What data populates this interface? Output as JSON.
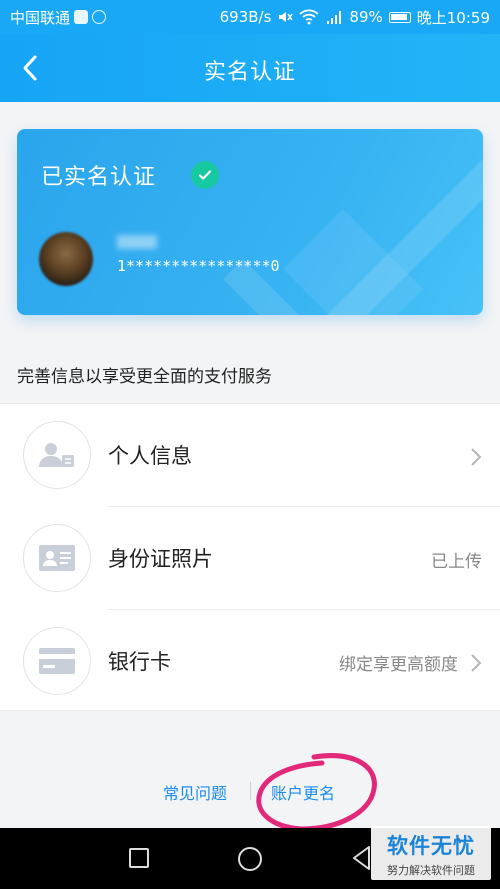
{
  "status_bar": {
    "carrier": "中国联通",
    "speed": "693B/s",
    "battery": "89%",
    "time": "晚上10:59"
  },
  "header": {
    "title": "实名认证"
  },
  "card": {
    "title": "已实名认证",
    "id_masked": "1****************0"
  },
  "subtitle": "完善信息以享受更全面的支付服务",
  "items": [
    {
      "label": "个人信息",
      "value": "",
      "icon": "person-info-icon"
    },
    {
      "label": "身份证照片",
      "value": "已上传",
      "icon": "id-card-icon"
    },
    {
      "label": "银行卡",
      "value": "绑定享更高额度",
      "icon": "bank-card-icon"
    }
  ],
  "footer": {
    "faq": "常见问题",
    "rename": "账户更名"
  },
  "watermark": {
    "title": "软件无忧",
    "subtitle": "努力解决软件问题"
  },
  "colors": {
    "accent": "#18a8f5",
    "verified": "#17c9a0",
    "link": "#1b8cf0",
    "annotation": "#e2287a"
  }
}
